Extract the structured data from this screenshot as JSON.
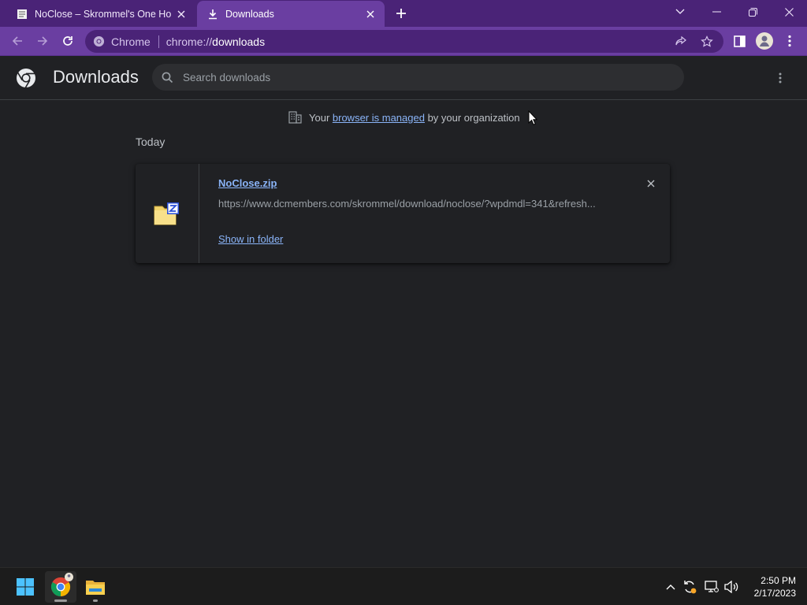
{
  "tabs": [
    {
      "title": "NoClose – Skrommel's One Hour",
      "active": false,
      "favicon": "page-icon"
    },
    {
      "title": "Downloads",
      "active": true,
      "favicon": "download-icon"
    }
  ],
  "omnibox": {
    "site_label": "Chrome",
    "url_scheme": "chrome://",
    "url_host": "downloads"
  },
  "page": {
    "title": "Downloads",
    "search_placeholder": "Search downloads",
    "managed": {
      "prefix": "Your ",
      "link": "browser is managed",
      "suffix": " by your organization"
    },
    "section": "Today"
  },
  "download": {
    "filename": "NoClose.zip",
    "url": "https://www.dcmembers.com/skrommel/download/noclose/?wpdmdl=341&refresh...",
    "action": "Show in folder"
  },
  "taskbar": {
    "time": "2:50 PM",
    "date": "2/17/2023"
  },
  "colors": {
    "tabstrip": "#4a2377",
    "toolbar": "#6a3ea1",
    "page_bg": "#202124",
    "link": "#8ab4f8"
  }
}
